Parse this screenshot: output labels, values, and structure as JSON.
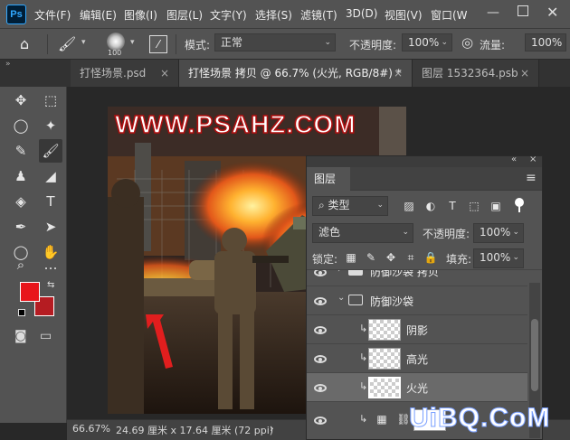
{
  "app": {
    "logo": "Ps"
  },
  "menu": {
    "items": [
      "文件(F)",
      "编辑(E)",
      "图像(I)",
      "图层(L)",
      "文字(Y)",
      "选择(S)",
      "滤镜(T)",
      "3D(D)",
      "视图(V)",
      "窗口(W"
    ]
  },
  "options": {
    "brush_size": "100",
    "mode_label": "模式:",
    "mode_value": "正常",
    "opacity_label": "不透明度:",
    "opacity_value": "100%",
    "flow_label": "流量:",
    "flow_value": "100%"
  },
  "tabs": [
    {
      "label": "打怪场景.psd",
      "close": "×"
    },
    {
      "label": "打怪场景 拷贝 @ 66.7% (火光, RGB/8#) *",
      "close": "×"
    },
    {
      "label": "图层 1532364.psb",
      "close": "×"
    }
  ],
  "toolbar": {
    "icons": [
      "move-icon",
      "marquee-icon",
      "lasso-icon",
      "magic-wand-icon",
      "eyedropper-icon",
      "brush-icon",
      "stamp-icon",
      "eraser-icon",
      "paint-bucket-icon",
      "type-icon",
      "pen-icon",
      "path-select-icon",
      "ellipse-icon",
      "hand-icon",
      "zoom-icon",
      "more-icon"
    ],
    "glyphs": [
      "✥",
      "⬚",
      "◯",
      "✦",
      "✎",
      "🖌",
      "♟",
      "◢",
      "◈",
      "T",
      "✒",
      "➤",
      "◯",
      "✋",
      "⌕",
      "…"
    ],
    "fg_color": "#e8151b",
    "bg_color": "#b51c22"
  },
  "canvas": {
    "watermark": "WWW.PSAHZ.COM"
  },
  "status": {
    "zoom": "66.67%",
    "size": "24.69 厘米 x 17.64 厘米 (72 ppi)",
    "arrow": "›"
  },
  "layers_panel": {
    "collapse": "«",
    "close": "×",
    "tab_label": "图层",
    "menu_icon": "≡",
    "filter_type": "类型",
    "blend_mode": "滤色",
    "opacity_label": "不透明度:",
    "opacity_value": "100%",
    "lock_label": "锁定:",
    "fill_label": "填充:",
    "fill_value": "100%",
    "layers": [
      {
        "name": "防御沙袋 拷贝",
        "kind": "group",
        "expanded": false
      },
      {
        "name": "防御沙袋",
        "kind": "group",
        "expanded": true
      },
      {
        "name": "阴影",
        "kind": "layer",
        "clipped": true
      },
      {
        "name": "高光",
        "kind": "layer",
        "clipped": true
      },
      {
        "name": "火光",
        "kind": "layer",
        "clipped": true,
        "selected": true
      },
      {
        "name": "",
        "kind": "adjustment",
        "clipped": true
      }
    ]
  },
  "watermark_overlay": "UiBQ.CoM"
}
